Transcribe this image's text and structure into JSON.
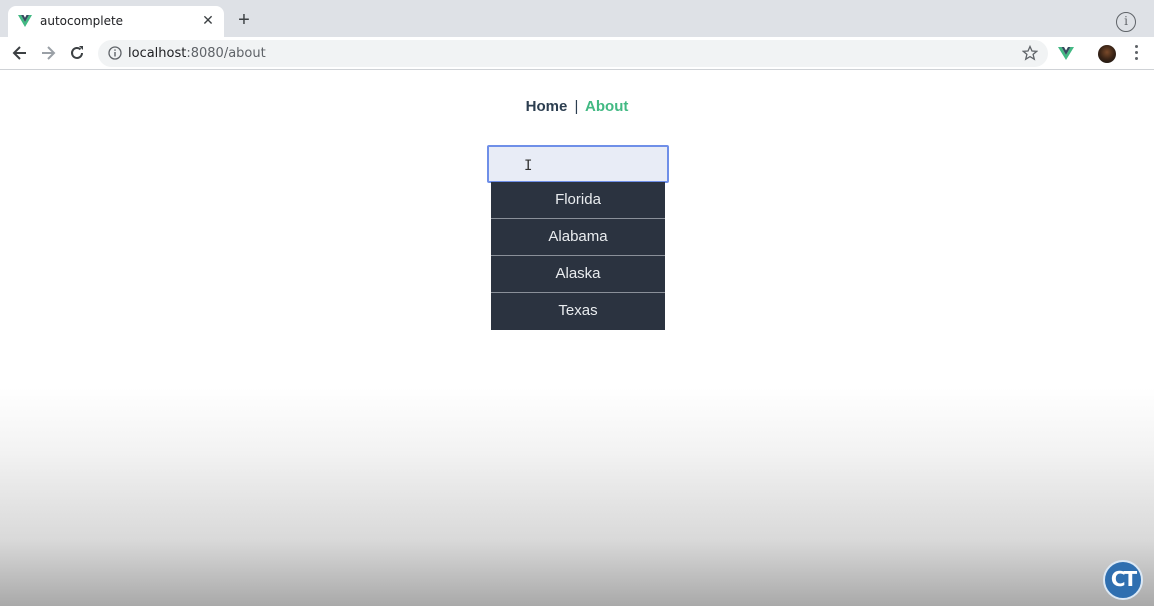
{
  "browser": {
    "tab": {
      "title": "autocomplete",
      "close_glyph": "✕"
    },
    "new_tab_glyph": "+",
    "info_glyph": "i",
    "address": {
      "host": "localhost",
      "path": ":8080/about"
    }
  },
  "nav": {
    "home": "Home",
    "separator": "|",
    "about": "About"
  },
  "search": {
    "value": "",
    "placeholder": ""
  },
  "suggestions": [
    "Florida",
    "Alabama",
    "Alaska",
    "Texas"
  ],
  "watermark": {
    "text": "CT"
  },
  "colors": {
    "accent": "#42b983",
    "nav_text": "#2c3e50",
    "dropdown_bg": "#2b3340",
    "input_border": "#6f8fe8"
  },
  "icons": {
    "favicon": "vue-logo-icon",
    "back": "arrow-left-icon",
    "forward": "arrow-right-icon",
    "reload": "reload-icon",
    "bookmark": "star-icon",
    "extension": "vue-devtools-icon",
    "menu": "kebab-menu-icon"
  }
}
